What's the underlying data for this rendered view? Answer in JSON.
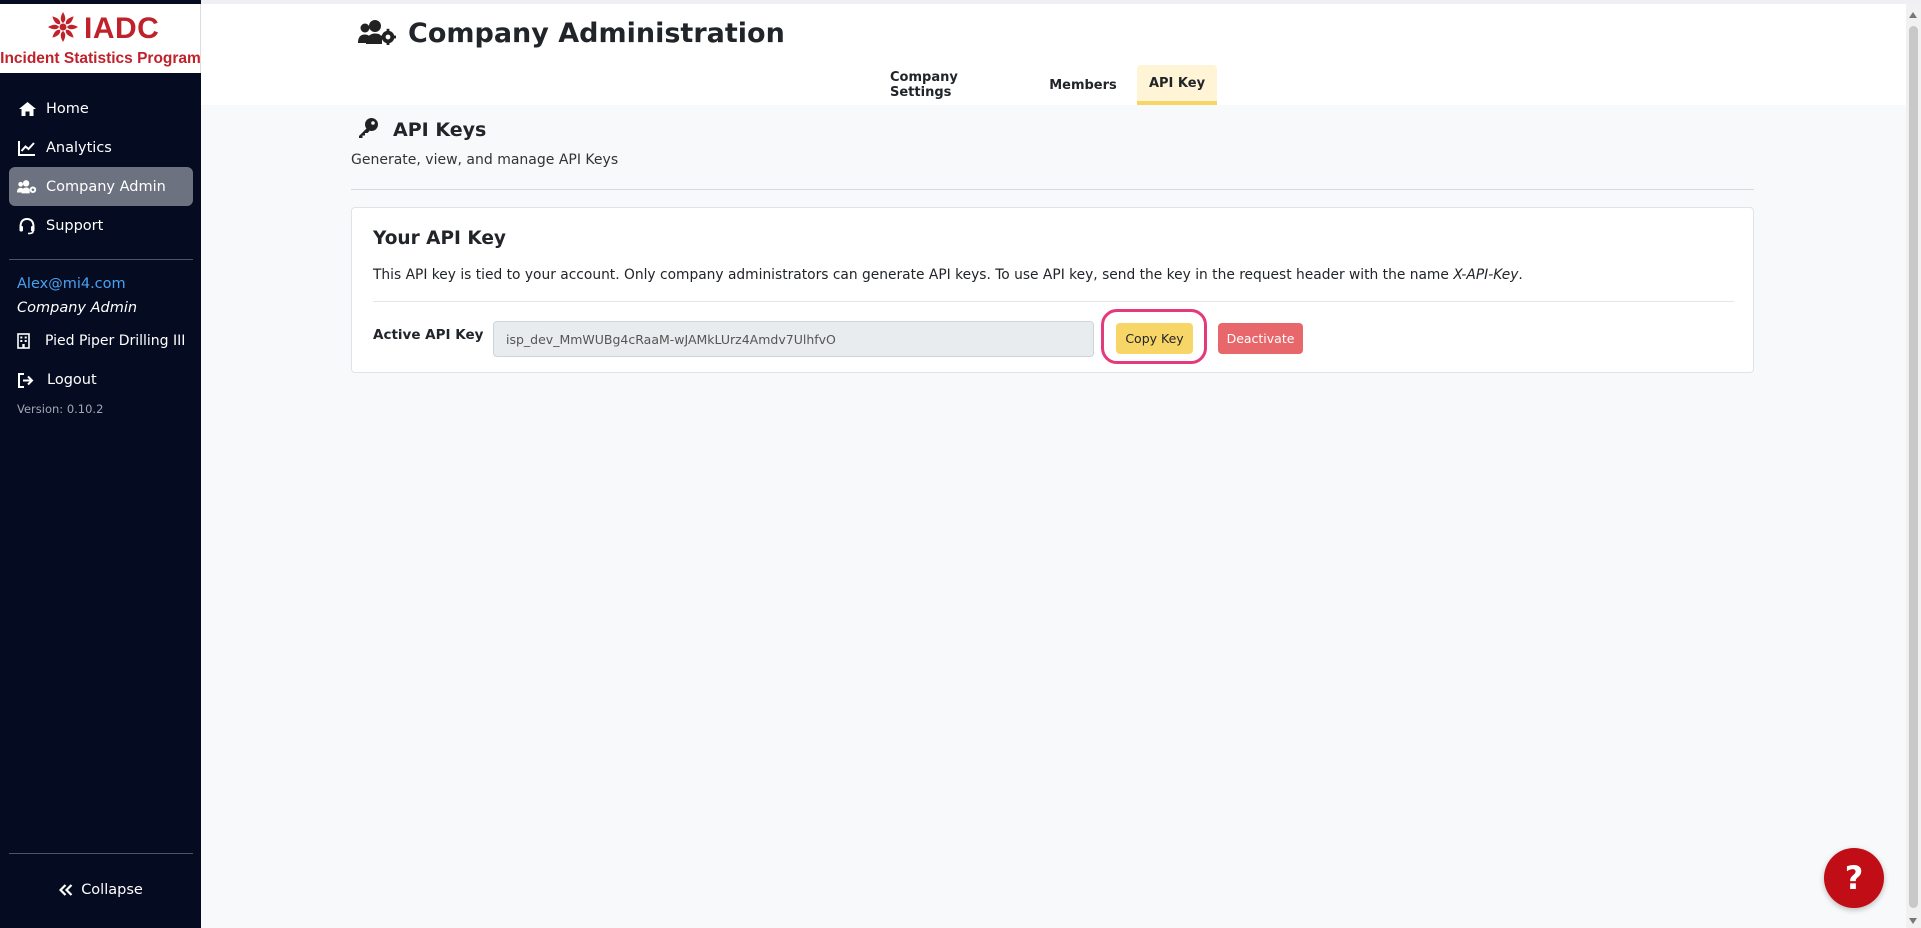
{
  "brand": {
    "logo_text": "IADC",
    "subtitle": "Incident Statistics Program",
    "color": "#c0222b"
  },
  "sidebar": {
    "items": [
      {
        "label": "Home",
        "icon": "home-icon",
        "active": false
      },
      {
        "label": "Analytics",
        "icon": "chart-line-icon",
        "active": false
      },
      {
        "label": "Company Admin",
        "icon": "users-cog-icon",
        "active": true
      },
      {
        "label": "Support",
        "icon": "headset-icon",
        "active": false
      }
    ],
    "user_email": "Alex@mi4.com",
    "user_role": "Company Admin",
    "company_name": "Pied Piper Drilling III",
    "logout_label": "Logout",
    "version": "Version: 0.10.2",
    "collapse_label": "Collapse"
  },
  "header": {
    "title": "Company Administration",
    "tabs": [
      {
        "label": "Company Settings",
        "active": false
      },
      {
        "label": "Members",
        "active": false
      },
      {
        "label": "API Key",
        "active": true
      }
    ]
  },
  "section": {
    "title": "API Keys",
    "subtitle": "Generate, view, and manage API Keys"
  },
  "card": {
    "title": "Your API Key",
    "description": "This API key is tied to your account. Only company administrators can generate API keys. To use API key, send the key in the request header with the name ",
    "header_name": "X-API-Key",
    "description_end": ".",
    "field_label": "Active API Key",
    "api_key_value": "isp_dev_MmWUBg4cRaaM-wJAMkLUrz4Amdv7UlhfvO",
    "copy_label": "Copy Key",
    "deactivate_label": "Deactivate"
  },
  "help": {
    "label": "?"
  },
  "colors": {
    "sidebar_bg": "#050b20",
    "accent_yellow": "#f7d567",
    "danger": "#e7676a",
    "highlight_ring": "#e4397a",
    "help_red": "#c10d15"
  }
}
